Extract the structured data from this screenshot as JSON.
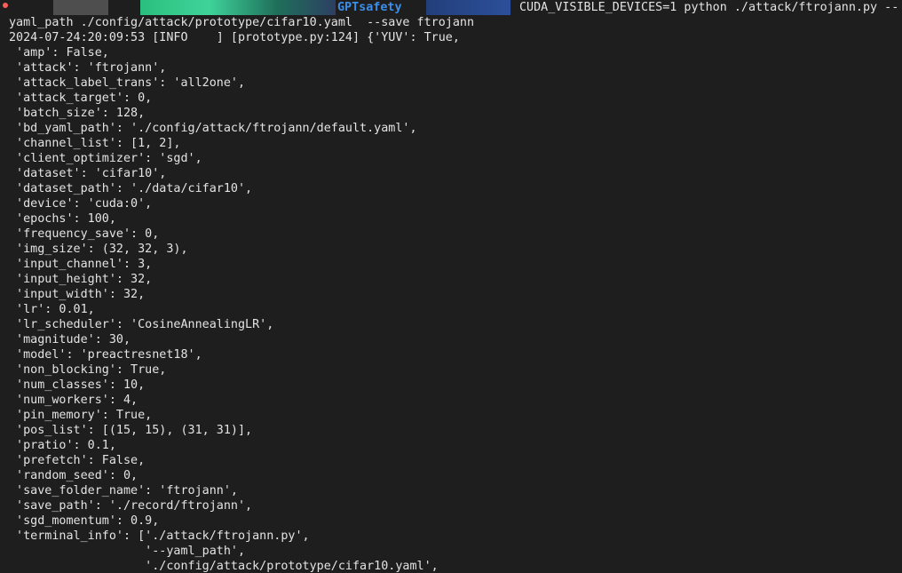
{
  "prompt": {
    "env_label": "GPTsafety",
    "command": "CUDA_VISIBLE_DEVICES=1 python ./attack/ftrojann.py --"
  },
  "lines": [
    "yaml_path ./config/attack/prototype/cifar10.yaml  --save ftrojann",
    "2024-07-24:20:09:53 [INFO    ] [prototype.py:124] {'YUV': True,",
    " 'amp': False,",
    " 'attack': 'ftrojann',",
    " 'attack_label_trans': 'all2one',",
    " 'attack_target': 0,",
    " 'batch_size': 128,",
    " 'bd_yaml_path': './config/attack/ftrojann/default.yaml',",
    " 'channel_list': [1, 2],",
    " 'client_optimizer': 'sgd',",
    " 'dataset': 'cifar10',",
    " 'dataset_path': './data/cifar10',",
    " 'device': 'cuda:0',",
    " 'epochs': 100,",
    " 'frequency_save': 0,",
    " 'img_size': (32, 32, 3),",
    " 'input_channel': 3,",
    " 'input_height': 32,",
    " 'input_width': 32,",
    " 'lr': 0.01,",
    " 'lr_scheduler': 'CosineAnnealingLR',",
    " 'magnitude': 30,",
    " 'model': 'preactresnet18',",
    " 'non_blocking': True,",
    " 'num_classes': 10,",
    " 'num_workers': 4,",
    " 'pin_memory': True,",
    " 'pos_list': [(15, 15), (31, 31)],",
    " 'pratio': 0.1,",
    " 'prefetch': False,",
    " 'random_seed': 0,",
    " 'save_folder_name': 'ftrojann',",
    " 'save_path': './record/ftrojann',",
    " 'sgd_momentum': 0.9,",
    " 'terminal_info': ['./attack/ftrojann.py',",
    "                   '--yaml_path',",
    "                   './config/attack/prototype/cifar10.yaml',"
  ]
}
